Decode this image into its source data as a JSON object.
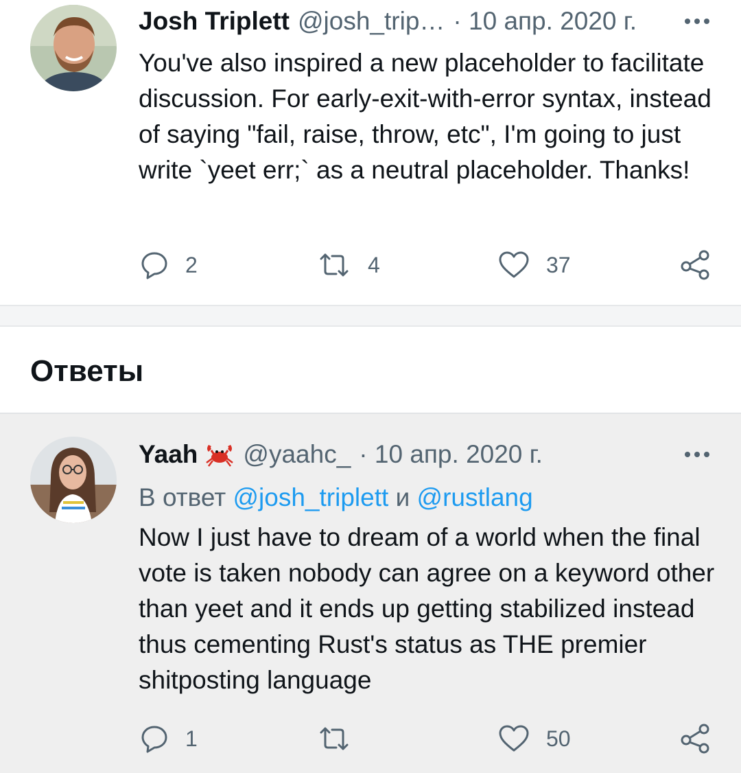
{
  "tweets": [
    {
      "author_name": "Josh Triplett",
      "handle": "@josh_trip…",
      "date": "· 10 апр. 2020 г.",
      "text": "You've also inspired a new placeholder to facilitate discussion. For early-exit-with-error syntax, instead of saying \"fail, raise, throw, etc\", I'm going to just write `yeet err;` as a neutral placeholder. Thanks!",
      "replies": "2",
      "retweets": "4",
      "likes": "37"
    },
    {
      "author_name": "Yaah",
      "author_emoji": "crab-icon",
      "handle": "@yaahc_",
      "date": "· 10 апр. 2020 г.",
      "reply_prefix": "В ответ",
      "reply_to_1": "@josh_triplett",
      "reply_joiner": "и",
      "reply_to_2": "@rustlang",
      "text": "Now I just have to dream of a world when the final vote is taken nobody can agree on a keyword other than yeet and it ends up getting stabilized instead thus cementing Rust's status as THE premier shitposting language",
      "replies": "1",
      "retweets": "",
      "likes": "50"
    }
  ],
  "section": {
    "title": "Ответы"
  },
  "icons": {
    "reply": "reply-icon",
    "retweet": "retweet-icon",
    "like": "heart-icon",
    "share": "share-icon",
    "more": "more-icon"
  },
  "colors": {
    "text_primary": "#0f1419",
    "text_secondary": "#536471",
    "mention": "#1d9bf0",
    "reply_background": "#efefef",
    "crab": "#d93025"
  }
}
